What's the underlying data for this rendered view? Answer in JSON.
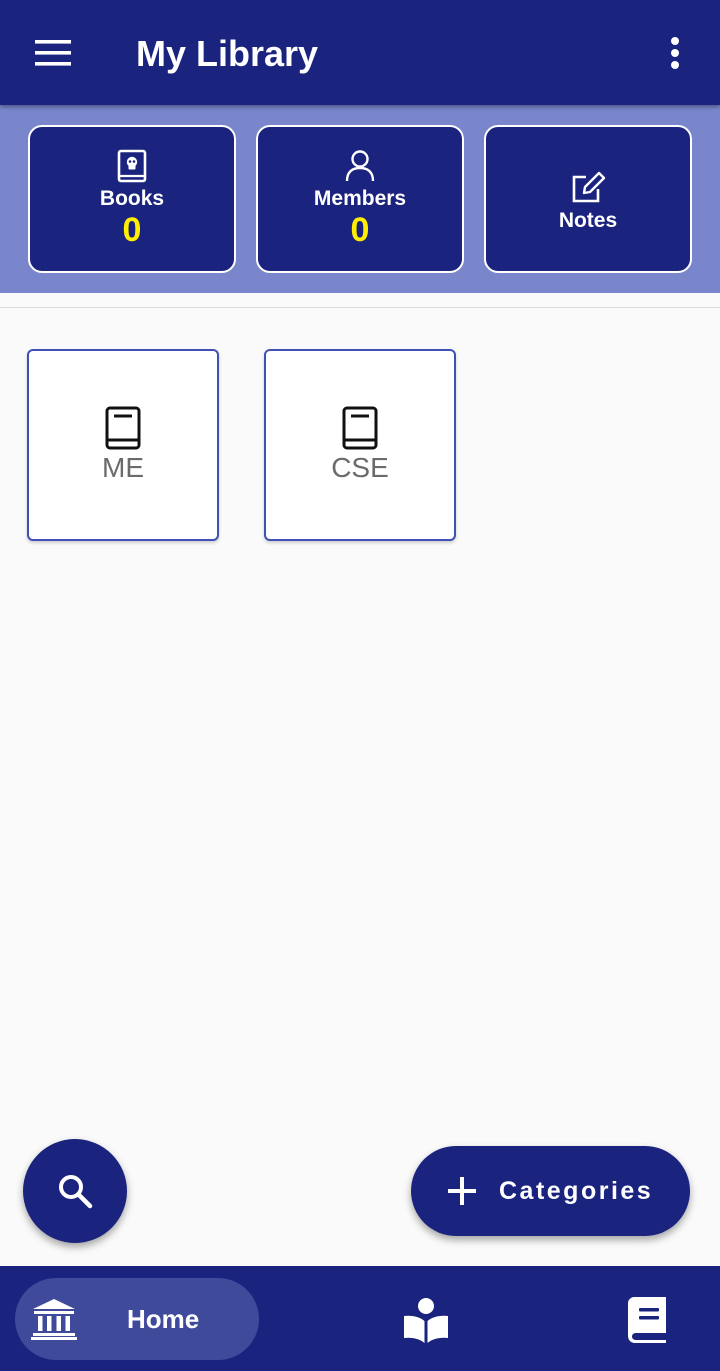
{
  "app_bar": {
    "title": "My Library",
    "menu_icon": "menu-icon",
    "more_icon": "more-vert-icon"
  },
  "stats": [
    {
      "label": "Books",
      "value": "0",
      "icon": "book-skull-icon"
    },
    {
      "label": "Members",
      "value": "0",
      "icon": "person-icon"
    },
    {
      "label": "Notes",
      "icon": "edit-note-icon"
    }
  ],
  "categories": [
    {
      "label": "ME",
      "icon": "book-icon"
    },
    {
      "label": "CSE",
      "icon": "book-icon"
    }
  ],
  "fab": {
    "search_icon": "search-icon",
    "add_label": "Categories",
    "add_icon": "plus-icon"
  },
  "bottom_nav": {
    "home_label": "Home",
    "home_icon": "library-building-icon",
    "read_icon": "reader-icon",
    "book_icon": "book-icon"
  },
  "colors": {
    "primary": "#1a237e",
    "stats_band": "#7986cb",
    "stat_value": "#ffee00",
    "card_border": "#3f51b5",
    "nav_active": "#3f4a9a"
  }
}
